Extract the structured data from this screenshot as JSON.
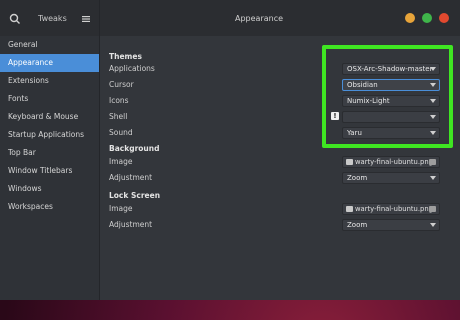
{
  "header": {
    "left_title": "Tweaks",
    "title": "Appearance"
  },
  "sidebar": {
    "items": [
      {
        "label": "General"
      },
      {
        "label": "Appearance"
      },
      {
        "label": "Extensions"
      },
      {
        "label": "Fonts"
      },
      {
        "label": "Keyboard & Mouse"
      },
      {
        "label": "Startup Applications"
      },
      {
        "label": "Top Bar"
      },
      {
        "label": "Window Titlebars"
      },
      {
        "label": "Windows"
      },
      {
        "label": "Workspaces"
      }
    ],
    "active_index": 1
  },
  "themes": {
    "title": "Themes",
    "applications": {
      "label": "Applications",
      "value": "OSX-Arc-Shadow-master"
    },
    "cursor": {
      "label": "Cursor",
      "value": "Obsidian"
    },
    "icons": {
      "label": "Icons",
      "value": "Numix-Light"
    },
    "shell": {
      "label": "Shell",
      "value": "",
      "warning": "!"
    },
    "sound": {
      "label": "Sound",
      "value": "Yaru"
    }
  },
  "background": {
    "title": "Background",
    "image": {
      "label": "Image",
      "value": "warty-final-ubuntu.png"
    },
    "adjustment": {
      "label": "Adjustment",
      "value": "Zoom"
    }
  },
  "lock_screen": {
    "title": "Lock Screen",
    "image": {
      "label": "Image",
      "value": "warty-final-ubuntu.png"
    },
    "adjustment": {
      "label": "Adjustment",
      "value": "Zoom"
    }
  },
  "colors": {
    "accent": "#4a8ed8",
    "highlight_box": "#3fe622",
    "min": "#e8a43a",
    "max": "#3fb54a",
    "close": "#e2492f"
  }
}
